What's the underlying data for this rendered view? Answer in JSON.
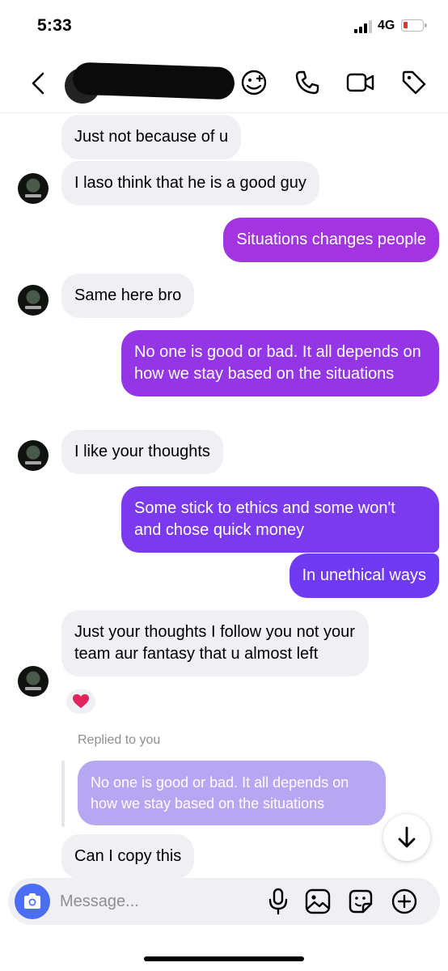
{
  "status_bar": {
    "time": "5:33",
    "network": "4G",
    "battery_level_percent": 10,
    "battery_color": "#e8312f"
  },
  "header": {
    "back_icon": "chevron-left-icon",
    "contact_name": "",
    "icons": [
      "games-icon",
      "phone-icon",
      "video-camera-icon",
      "tag-icon"
    ]
  },
  "colors": {
    "incoming_bubble": "#efeff4",
    "outgoing_top": "#a135e3",
    "outgoing_bottom": "#6c3af0",
    "reply_preview": "#b7a7f3",
    "composer_camera": "#4c6ef5"
  },
  "messages": [
    {
      "direction": "incoming",
      "text": "Just not because of u"
    },
    {
      "direction": "incoming",
      "text": "I laso think that he is a good guy"
    },
    {
      "direction": "outgoing",
      "text": "Situations changes people"
    },
    {
      "direction": "incoming",
      "text": "Same here bro"
    },
    {
      "direction": "outgoing",
      "text": "No one is good or bad. It all depends on how we stay based on the situations"
    },
    {
      "direction": "incoming",
      "text": "I like your thoughts"
    },
    {
      "direction": "outgoing",
      "text": "Some stick to ethics and some won't and chose quick money"
    },
    {
      "direction": "outgoing",
      "text": "In unethical ways"
    },
    {
      "direction": "incoming",
      "text": "Just your thoughts I follow you not your team aur fantasy that u almost left",
      "reaction": "heart-icon"
    },
    {
      "direction": "incoming",
      "text": "Can I copy this"
    }
  ],
  "reply": {
    "label": "Replied to you",
    "quoted_text": "No one is good or bad. It all depends on how we stay based on the situations"
  },
  "composer": {
    "placeholder": "Message...",
    "icons": [
      "camera-icon",
      "microphone-icon",
      "image-icon",
      "sticker-icon",
      "plus-icon"
    ]
  }
}
